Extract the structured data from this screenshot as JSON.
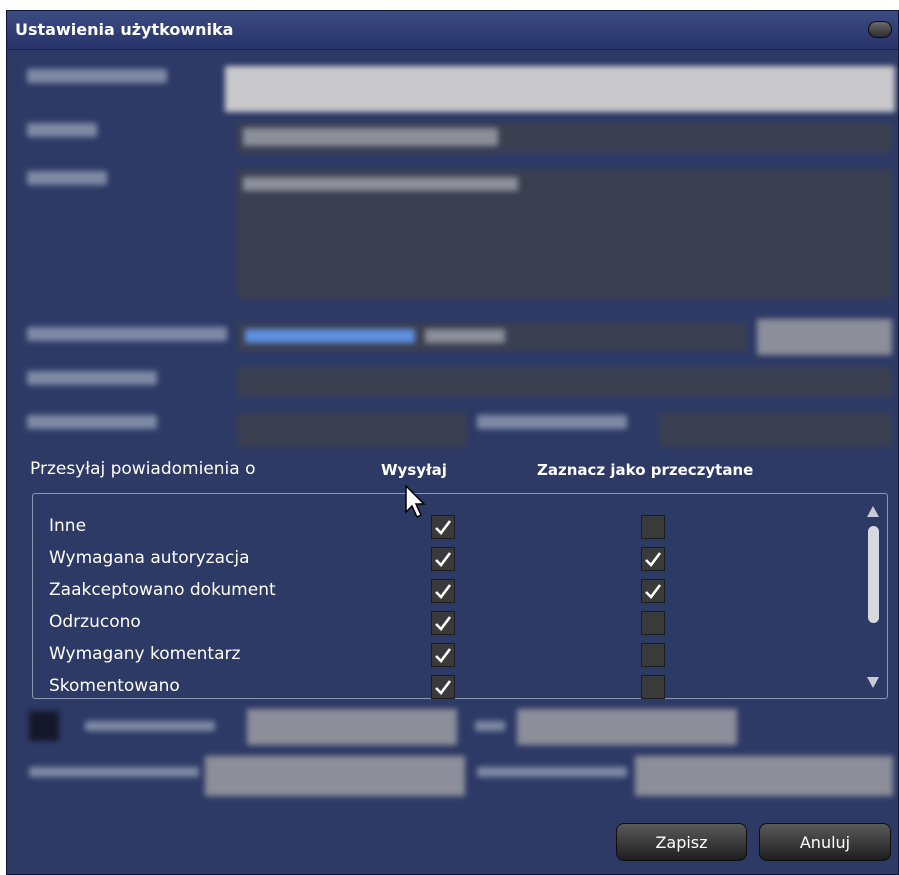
{
  "dialog": {
    "title": "Ustawienia użytkownika"
  },
  "notifications": {
    "section_label": "Przesyłaj powiadomienia o",
    "col_send": "Wysyłaj",
    "col_mark_read": "Zaznacz jako przeczytane",
    "rows": [
      {
        "label": "Inne",
        "send": true,
        "mark_read": false
      },
      {
        "label": "Wymagana autoryzacja",
        "send": true,
        "mark_read": true
      },
      {
        "label": "Zaakceptowano dokument",
        "send": true,
        "mark_read": true
      },
      {
        "label": "Odrzucono",
        "send": true,
        "mark_read": false
      },
      {
        "label": "Wymagany komentarz",
        "send": true,
        "mark_read": false
      },
      {
        "label": "Skomentowano",
        "send": true,
        "mark_read": false
      }
    ]
  },
  "buttons": {
    "save": "Zapisz",
    "cancel": "Anuluj"
  },
  "colors": {
    "dialog_bg": "#2d3a66",
    "checkbox_bg": "#3a3a3a",
    "check_mark": "#ffffff"
  }
}
